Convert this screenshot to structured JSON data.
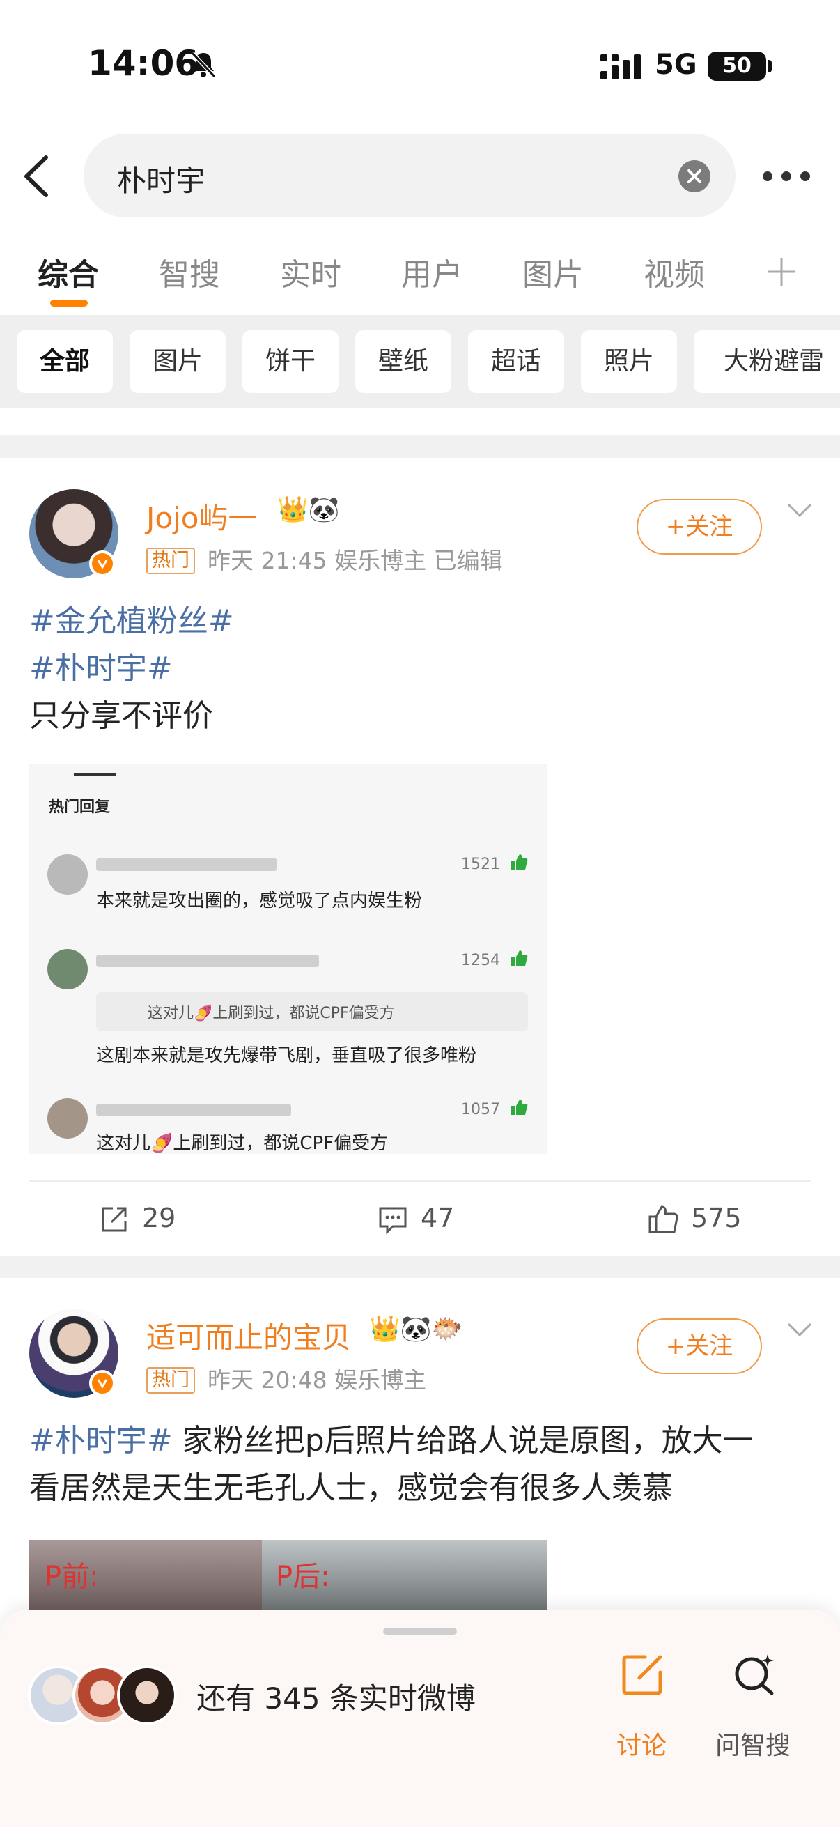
{
  "status_bar": {
    "time": "14:06",
    "network": "5G",
    "battery": "50"
  },
  "search": {
    "query": "朴时宇"
  },
  "tabs": [
    "综合",
    "智搜",
    "实时",
    "用户",
    "图片",
    "视频"
  ],
  "filters": [
    "全部",
    "图片",
    "饼干",
    "壁纸",
    "超话",
    "照片",
    "大粉避雷"
  ],
  "posts": [
    {
      "username": "Jojo屿一",
      "badges": "👑🐼",
      "hot_tag": "热门",
      "meta": "昨天 21:45   娱乐博主   已编辑",
      "follow_label": "+关注",
      "hashtag1": "#金允植粉丝#",
      "hashtag2": "#朴时宇#",
      "text": "只分享不评价",
      "embed": {
        "header": "热门回复",
        "comments": [
          {
            "count": "1521",
            "text": "本来就是攻出圈的，感觉吸了点内娱生粉"
          },
          {
            "count": "1254",
            "quote": "这对儿🍠上刷到过，都说CPF偏受方",
            "text": "这剧本来就是攻先爆带飞剧，垂直吸了很多唯粉"
          },
          {
            "count": "1057",
            "text": "这对儿🍠上刷到过，都说CPF偏受方"
          }
        ]
      },
      "reposts": "29",
      "comments": "47",
      "likes": "575"
    },
    {
      "username": "适可而止的宝贝",
      "badges": "👑🐼🐡",
      "hot_tag": "热门",
      "meta": "昨天 20:48   娱乐博主",
      "follow_label": "+关注",
      "hashtag": "#朴时宇#",
      "text_line1": " 家粉丝把p后照片给路人说是原图，放大一",
      "text_line2": "看居然是天生无毛孔人士，感觉会有很多人羡慕",
      "image_labels": [
        "P前:",
        "P后:"
      ]
    }
  ],
  "bottom_sheet": {
    "text": "还有 345 条实时微博",
    "discuss_label": "讨论",
    "ask_label": "问智搜"
  },
  "colors": {
    "accent": "#ff8200",
    "hashtag": "#4a6fa5",
    "username": "#f07d1e"
  }
}
